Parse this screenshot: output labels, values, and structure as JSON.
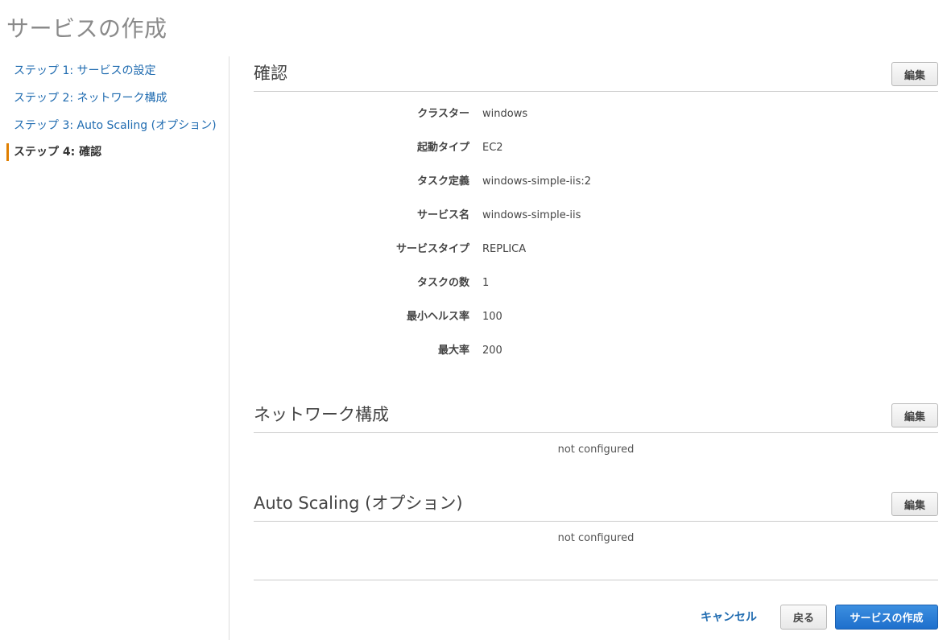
{
  "page": {
    "title": "サービスの作成"
  },
  "steps": [
    {
      "label": "ステップ 1: サービスの設定"
    },
    {
      "label": "ステップ 2: ネットワーク構成"
    },
    {
      "label": "ステップ 3: Auto Scaling (オプション)"
    },
    {
      "label": "ステップ 4: 確認"
    }
  ],
  "review": {
    "title": "確認",
    "edit_label": "編集",
    "rows": [
      {
        "label": "クラスター",
        "value": "windows"
      },
      {
        "label": "起動タイプ",
        "value": "EC2"
      },
      {
        "label": "タスク定義",
        "value": "windows-simple-iis:2"
      },
      {
        "label": "サービス名",
        "value": "windows-simple-iis"
      },
      {
        "label": "サービスタイプ",
        "value": "REPLICA"
      },
      {
        "label": "タスクの数",
        "value": "1"
      },
      {
        "label": "最小ヘルス率",
        "value": "100"
      },
      {
        "label": "最大率",
        "value": "200"
      }
    ]
  },
  "network": {
    "title": "ネットワーク構成",
    "edit_label": "編集",
    "status": "not configured"
  },
  "autoscaling": {
    "title": "Auto Scaling (オプション)",
    "edit_label": "編集",
    "status": "not configured"
  },
  "footer": {
    "cancel_label": "キャンセル",
    "back_label": "戻る",
    "create_label": "サービスの作成"
  },
  "colors": {
    "link": "#1f6bb0",
    "active_marker": "#e07f00",
    "primary_button": "#1e6fcc"
  }
}
